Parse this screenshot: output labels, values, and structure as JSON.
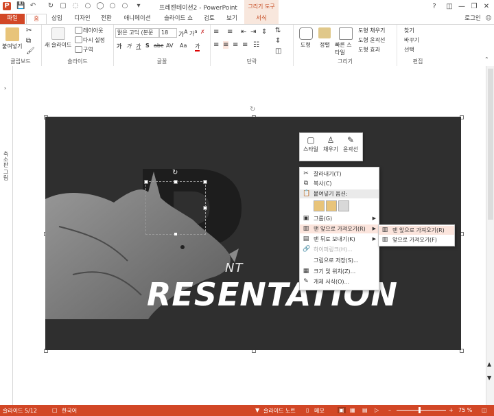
{
  "window": {
    "title": "프레젠테이션2 - PowerPoint",
    "context_header": "그리기 도구",
    "user": "로그인",
    "min_glyph": "—",
    "max_glyph": "❐",
    "close_glyph": "✕",
    "help_glyph": "?"
  },
  "tabs": [
    "파일",
    "홈",
    "삽입",
    "디자인",
    "전환",
    "애니메이션",
    "슬라이드 쇼",
    "검토",
    "보기",
    "서식"
  ],
  "ribbon": {
    "clipboard": {
      "paste": "붙여넣기",
      "label": "클립보드"
    },
    "slides": {
      "new_slide": "새 슬라이드",
      "layout": "레이아웃",
      "reset": "다시 설정",
      "section": "구역",
      "label": "슬라이드"
    },
    "font": {
      "font_name": "맑은 고딕 (본문",
      "font_size": "18",
      "bold": "가",
      "italic": "가",
      "underline": "가",
      "shadow": "S",
      "strike": "abc",
      "spacing": "AV",
      "case": "Aa",
      "color": "가",
      "label": "글꼴"
    },
    "paragraph": {
      "label": "단락"
    },
    "drawing": {
      "shapes": "도형",
      "arrange": "정렬",
      "quick_styles": "빠른 스타일",
      "fill": "도형 채우기",
      "outline": "도형 윤곽선",
      "effects": "도형 효과",
      "label": "그리기"
    },
    "editing": {
      "find": "찾기",
      "replace": "바꾸기",
      "select": "선택",
      "label": "편집"
    }
  },
  "thumbpane": {
    "label": "축소판 그림"
  },
  "slide": {
    "title_small": "NT",
    "title_big": "RESENTATION",
    "big_letter": "P"
  },
  "mini_toolbar": {
    "style": "스타일",
    "fill": "채우기",
    "outline": "윤곽선"
  },
  "context_menu": {
    "cut": "잘라내기(T)",
    "copy": "복사(C)",
    "paste_options": "붙여넣기 옵션:",
    "group": "그룹(G)",
    "bring_front": "맨 앞으로 가져오기(R)",
    "send_back": "맨 뒤로 보내기(K)",
    "hyperlink": "하이퍼링크(H)...",
    "save_picture": "그림으로 저장(S)...",
    "size_position": "크기 및 위치(Z)...",
    "format_object": "개체 서식(O)..."
  },
  "submenu": {
    "bring_to_front": "맨 앞으로 가져오기(R)",
    "bring_forward": "앞으로 가져오기(F)"
  },
  "status": {
    "slide": "슬라이드 5/12",
    "lang": "한국어",
    "notes": "슬라이드 노트",
    "memo": "메모",
    "zoom": "75 %"
  },
  "colors": {
    "accent": "#d24726",
    "slide_bg": "#2f2f2f"
  }
}
